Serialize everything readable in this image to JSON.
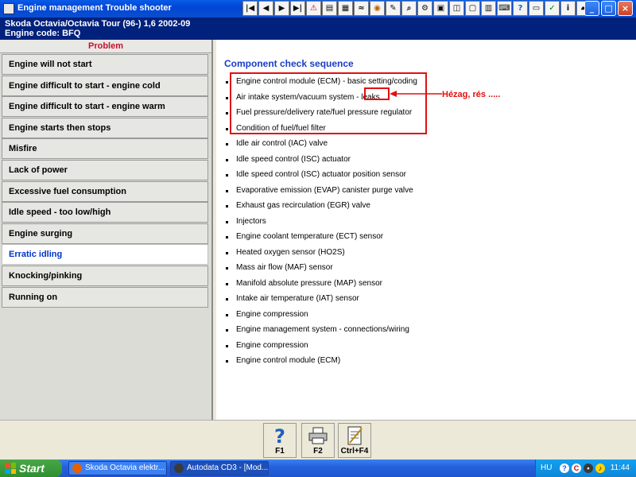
{
  "window": {
    "title": "Engine management Trouble shooter",
    "toolbar_icons": [
      "first-page-icon",
      "previous-page-icon",
      "next-page-icon",
      "last-page-icon",
      "warning-icon",
      "document-icon",
      "map-icon",
      "wiring-icon",
      "component-icon",
      "tools-icon",
      "search-icon",
      "settings-icon",
      "gallery-icon",
      "diagram-icon",
      "camera-icon",
      "database-icon",
      "keyboard-icon",
      "help-icon",
      "print-icon",
      "test-icon",
      "info-icon",
      "car-icon"
    ],
    "controls": {
      "minimize": "_",
      "maximize": "□",
      "close": "×"
    }
  },
  "vehicle": {
    "line1": "Skoda   Octavia/Octavia Tour (96-) 1,6  2002-09",
    "line2": "Engine code: BFQ"
  },
  "problems": {
    "header": "Problem",
    "active_index": 9,
    "items": [
      "Engine will not start",
      "Engine difficult to start - engine cold",
      "Engine difficult to start - engine warm",
      "Engine starts then stops",
      "Misfire",
      "Lack of power",
      "Excessive fuel consumption",
      "Idle speed - too low/high",
      "Engine surging",
      "Erratic idling",
      "Knocking/pinking",
      "Running on"
    ]
  },
  "sequence": {
    "title": "Component check sequence",
    "items": [
      "Engine control module (ECM) - basic setting/coding",
      "Air intake system/vacuum system - leaks",
      "Fuel pressure/delivery rate/fuel pressure regulator",
      "Condition of fuel/fuel filter",
      "Idle air control (IAC) valve",
      "Idle speed control (ISC) actuator",
      "Idle speed control (ISC) actuator position sensor",
      "Evaporative emission (EVAP) canister purge valve",
      "Exhaust gas recirculation (EGR) valve",
      "Injectors",
      "Engine coolant temperature (ECT) sensor",
      "Heated oxygen sensor (HO2S)",
      "Mass air flow (MAF) sensor",
      "Manifold absolute pressure (MAP) sensor",
      "Intake air temperature (IAT) sensor",
      "Engine compression",
      "Engine management system - connections/wiring",
      "Engine compression",
      "Engine control module (ECM)"
    ]
  },
  "annotation": {
    "text": "Hézag, rés  .....",
    "color": "#e01010"
  },
  "function_keys": [
    {
      "label": "F1",
      "icon": "help-question-icon"
    },
    {
      "label": "F2",
      "icon": "printer-icon"
    },
    {
      "label": "Ctrl+F4",
      "icon": "notepad-icon"
    }
  ],
  "taskbar": {
    "start_label": "Start",
    "tasks": [
      {
        "label": "Skoda Octavia elektr...",
        "icon": "firefox-icon"
      },
      {
        "label": "Autodata CD3 - [Mod...",
        "icon": "autodata-icon"
      }
    ],
    "language": "HU",
    "clock": "11:44"
  },
  "colors": {
    "accent_blue": "#1a3dc8",
    "header_navy": "#00217c",
    "problem_red": "#c8102e",
    "active_item_text": "#0033cc"
  }
}
